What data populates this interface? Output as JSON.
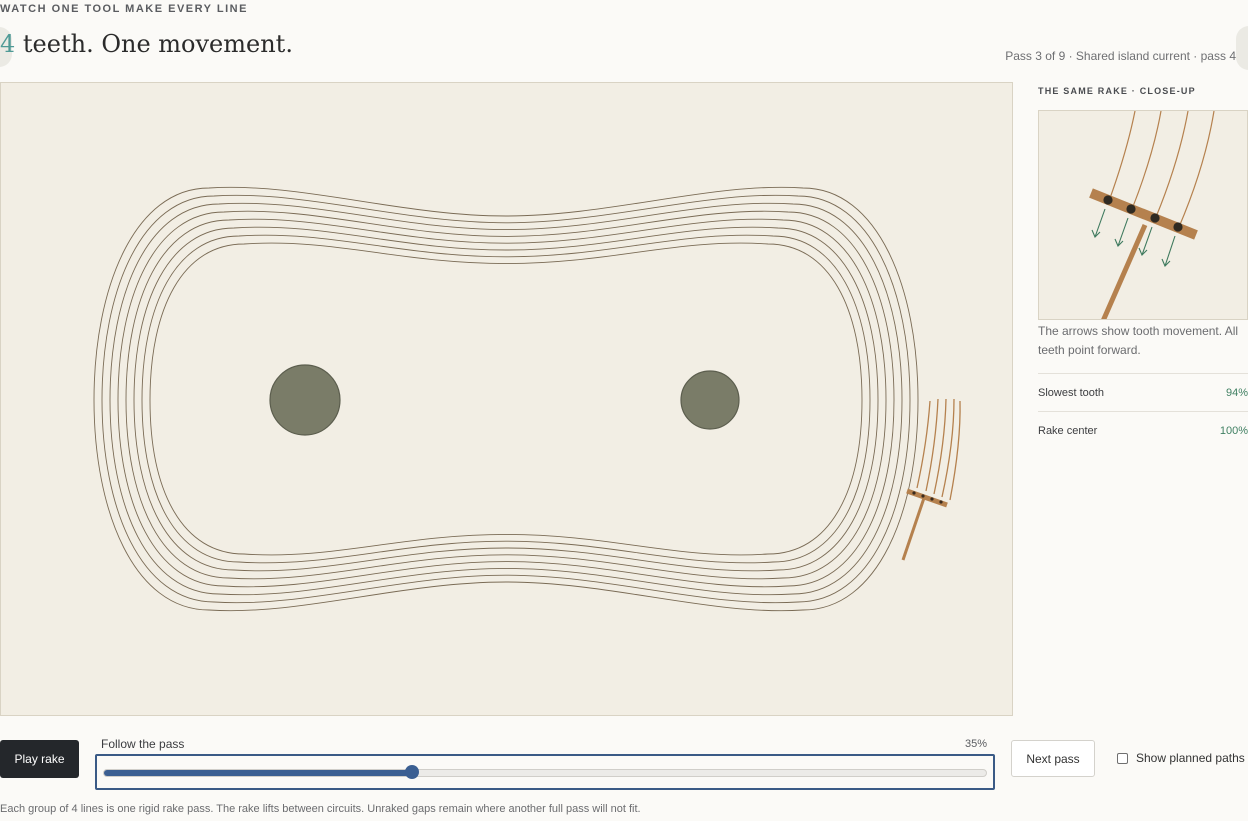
{
  "header": {
    "eyebrow": "WATCH ONE TOOL MAKE EVERY LINE",
    "title_digit": "4",
    "title_rest": " teeth. One movement.",
    "pass_status": "Pass 3 of 9 · Shared island current · pass 4"
  },
  "side_panel": {
    "title": "THE SAME RAKE · CLOSE-UP",
    "caption": "The arrows show tooth movement. All teeth point forward.",
    "stats": [
      {
        "label": "Slowest tooth",
        "value": "94%"
      },
      {
        "label": "Rake center",
        "value": "100%"
      }
    ]
  },
  "controls": {
    "play_label": "Play rake",
    "slider_label": "Follow the pass",
    "progress_percent": 35,
    "progress_text": "35%",
    "next_label": "Next pass",
    "planned_label": "Show planned paths",
    "planned_checked": false
  },
  "footnote": "Each group of 4 lines is one rigid rake pass. The rake lifts between circuits. Unraked gaps remain where another full pass will not fit.",
  "colors": {
    "sand": "#f2eee4",
    "rock": "#7a7c68",
    "rake": "#b5814e",
    "line": "#7a6b55",
    "arrow": "#3f7a5e",
    "accent": "#3b5f92"
  }
}
